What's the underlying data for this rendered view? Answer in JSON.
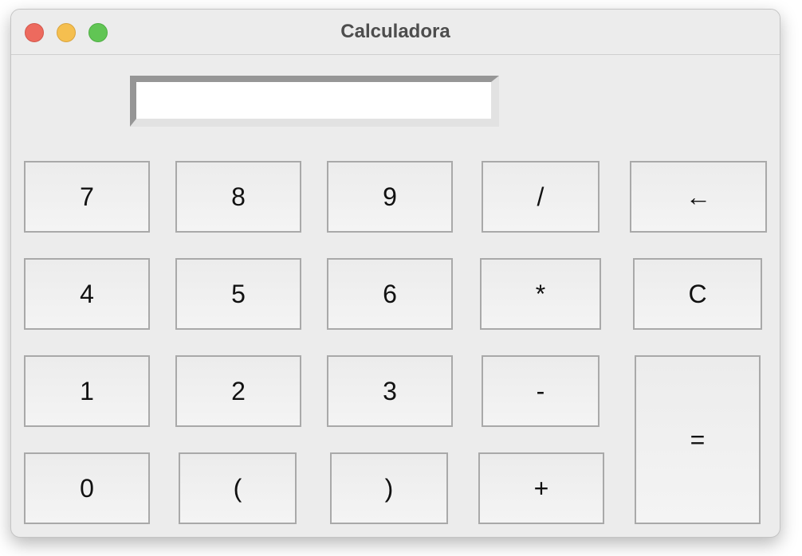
{
  "window": {
    "title": "Calculadora"
  },
  "display": {
    "value": ""
  },
  "keys": {
    "seven": "7",
    "eight": "8",
    "nine": "9",
    "divide": "/",
    "backspace": "←",
    "four": "4",
    "five": "5",
    "six": "6",
    "multiply": "*",
    "clear": "C",
    "one": "1",
    "two": "2",
    "three": "3",
    "minus": "-",
    "equals": "=",
    "zero": "0",
    "open_paren": "(",
    "close_paren": ")",
    "plus": "+"
  },
  "colors": {
    "close": "#ed6a5e",
    "minimize": "#f5bf4f",
    "zoom": "#61c554",
    "window_bg": "#ececec"
  }
}
